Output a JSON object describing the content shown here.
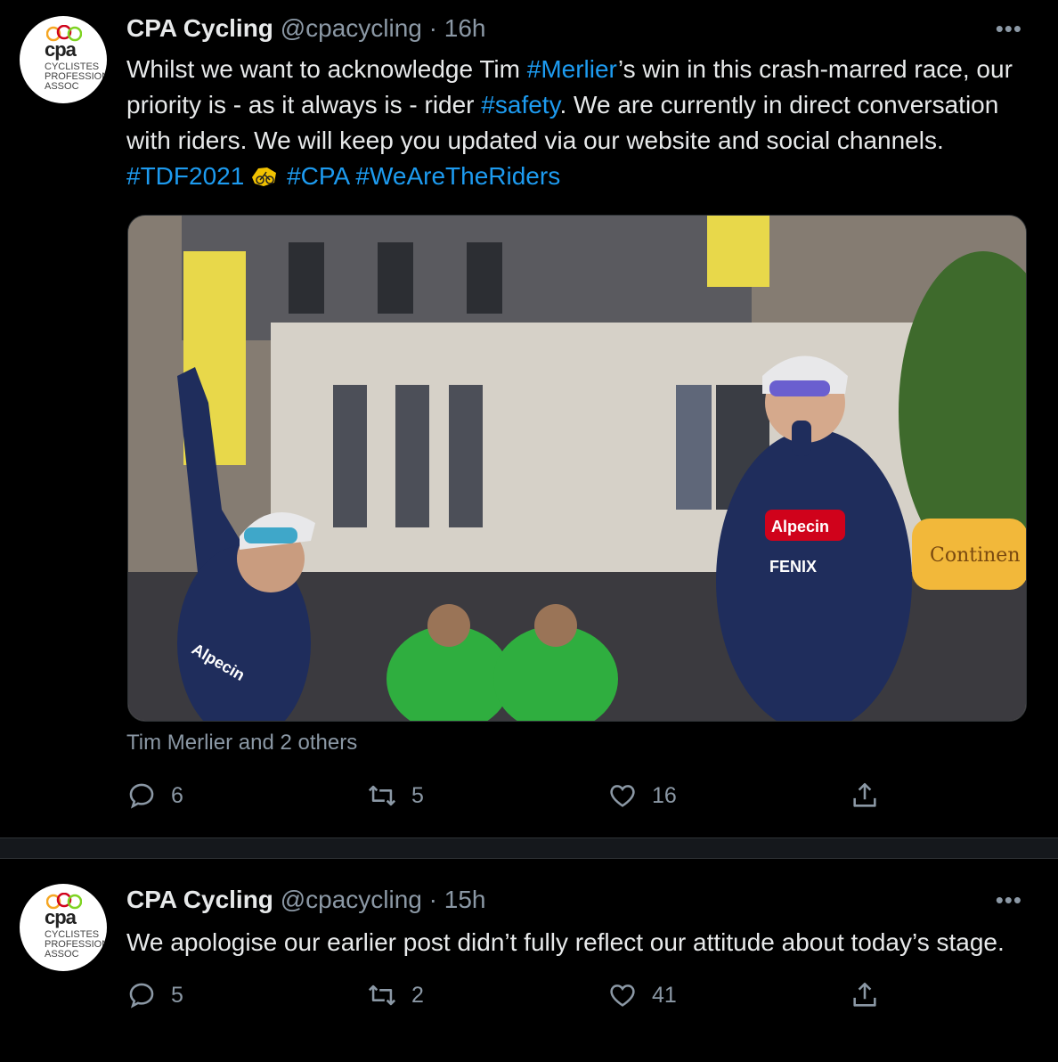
{
  "tweets": [
    {
      "name": "CPA Cycling",
      "handle": "@cpacycling",
      "separator": "·",
      "time": "16h",
      "avatar": {
        "brand": "cpa",
        "subtitle_1": "CYCLISTES",
        "subtitle_2": "PROFESSIONNELS",
        "subtitle_3": "ASSOC"
      },
      "text_parts": {
        "p1": "Whilst we want to acknowledge Tim ",
        "tag1": "#Merlier",
        "p2": "’s win in this crash-marred race, our priority is - as it always is - rider ",
        "tag2": "#safety",
        "p3": ". We are currently in direct conversation with riders. We will keep you updated via our website and social channels. ",
        "tag3": "#TDF2021",
        "p4": " ",
        "tag4": "#CPA",
        "p5": " ",
        "tag5": "#WeAreTheRiders"
      },
      "media_tags_caption": "Tim Merlier and 2 others",
      "media_signs": {
        "jersey1": "Alpecin",
        "jersey2": "FENIX",
        "banner": "Continen"
      },
      "counts": {
        "replies": "6",
        "retweets": "5",
        "likes": "16"
      }
    },
    {
      "name": "CPA Cycling",
      "handle": "@cpacycling",
      "separator": "·",
      "time": "15h",
      "avatar": {
        "brand": "cpa",
        "subtitle_1": "CYCLISTES",
        "subtitle_2": "PROFESSIONNELS",
        "subtitle_3": "ASSOC"
      },
      "text": "We apologise our earlier post didn’t fully reflect our attitude about today’s stage.",
      "counts": {
        "replies": "5",
        "retweets": "2",
        "likes": "41"
      }
    }
  ],
  "colors": {
    "link": "#1d9bf0",
    "muted": "#8b98a5",
    "background": "#000000"
  }
}
